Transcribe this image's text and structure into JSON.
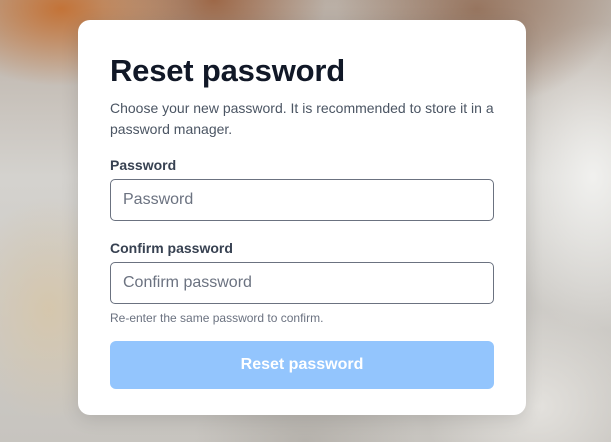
{
  "card": {
    "title": "Reset password",
    "description": "Choose your new password. It is recommended to store it in a password manager."
  },
  "password": {
    "label": "Password",
    "placeholder": "Password",
    "value": ""
  },
  "confirm_password": {
    "label": "Confirm password",
    "placeholder": "Confirm password",
    "value": "",
    "hint": "Re-enter the same password to confirm."
  },
  "submit": {
    "label": "Reset password",
    "disabled": true
  },
  "colors": {
    "submit_disabled": "#93c5fd",
    "title": "#111827",
    "input_border": "#6b7280"
  }
}
